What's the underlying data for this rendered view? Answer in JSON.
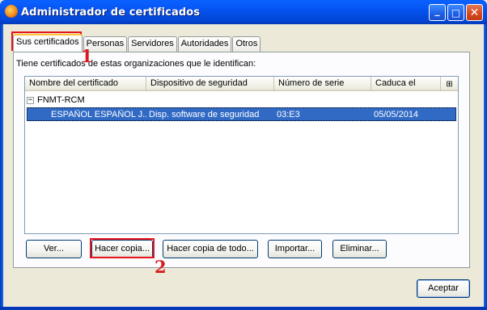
{
  "window": {
    "title": "Administrador de certificados",
    "icon": "firefox-icon",
    "controls": [
      "minimize",
      "maximize",
      "close"
    ],
    "control_glyphs": {
      "minimize": "_",
      "maximize": "□",
      "close": "✕"
    }
  },
  "tabs": [
    {
      "label": "Sus certificados",
      "active": true
    },
    {
      "label": "Personas",
      "active": false
    },
    {
      "label": "Servidores",
      "active": false
    },
    {
      "label": "Autoridades",
      "active": false
    },
    {
      "label": "Otros",
      "active": false
    }
  ],
  "intro_text": "Tiene certificados de estas organizaciones que le identifican:",
  "table": {
    "columns": [
      "Nombre del certificado",
      "Dispositivo de seguridad",
      "Número de serie",
      "Caduca el"
    ],
    "column_picker_glyph": "⊞",
    "groups": [
      {
        "name": "FNMT-RCM",
        "expander": "−",
        "rows": [
          {
            "name": "ESPAÑOL ESPAÑOL J...",
            "device": "Disp. software de seguridad",
            "serial": "03:E3",
            "expires": "05/05/2014",
            "selected": true
          }
        ]
      }
    ]
  },
  "buttons": {
    "view": "Ver...",
    "backup": "Hacer copia...",
    "backup_all": "Hacer copia de todo...",
    "import": "Importar...",
    "delete": "Eliminar...",
    "accept": "Aceptar"
  },
  "annotations": [
    {
      "marker": "1",
      "target": "Sus certificados tab"
    },
    {
      "marker": "2",
      "target": "Hacer copia... button"
    }
  ],
  "colors": {
    "titlebar": "#0553f0",
    "selection": "#316ac5",
    "annotation": "#e8141b",
    "dialog_bg": "#ece9d8"
  }
}
